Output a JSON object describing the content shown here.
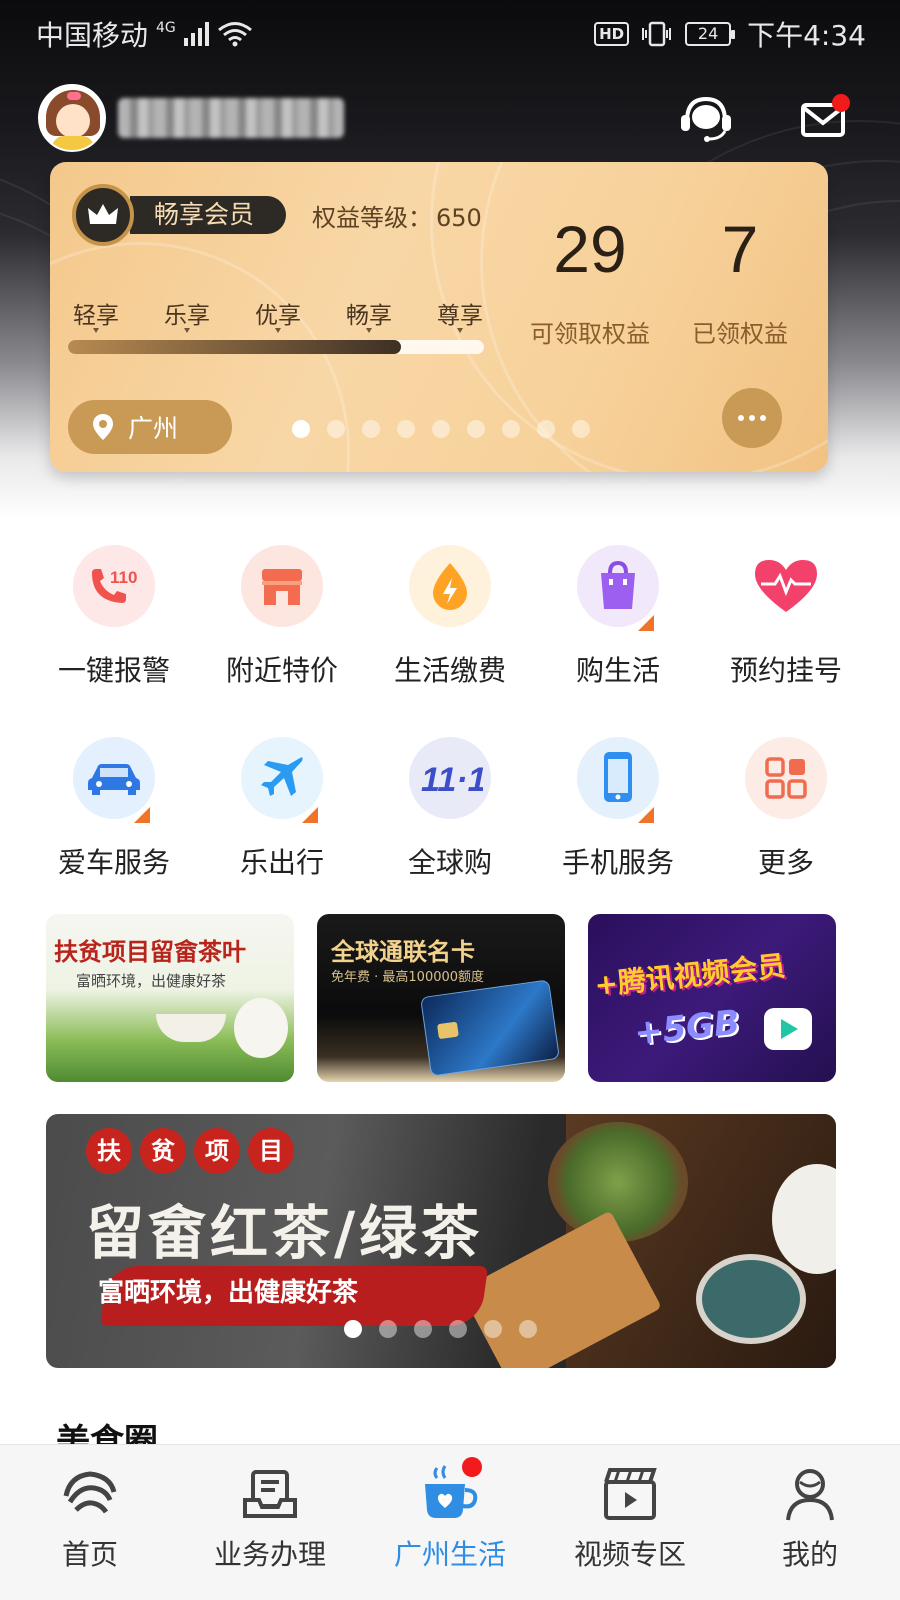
{
  "status_bar": {
    "carrier": "中国移动",
    "network": "4G",
    "hd": "HD",
    "battery": "24",
    "time": "下午4:34"
  },
  "profile": {
    "phone_masked": ""
  },
  "member_card": {
    "tier_name": "畅享会员",
    "level_label": "权益等级：",
    "level_value": "650",
    "tiers": [
      "轻享",
      "乐享",
      "优享",
      "畅享",
      "尊享"
    ],
    "progress": 0.8,
    "available_count": "29",
    "available_label": "可领取权益",
    "claimed_count": "7",
    "claimed_label": "已领权益",
    "location": "广州",
    "page_dots": 9,
    "active_dot": 0
  },
  "services": [
    {
      "label": "一键报警",
      "icon": "alarm-phone-icon",
      "corner": false
    },
    {
      "label": "附近特价",
      "icon": "store-icon",
      "corner": false
    },
    {
      "label": "生活缴费",
      "icon": "utility-drop-icon",
      "corner": false
    },
    {
      "label": "购生活",
      "icon": "shopping-bag-icon",
      "corner": true
    },
    {
      "label": "预约挂号",
      "icon": "heartbeat-icon",
      "corner": false
    },
    {
      "label": "爱车服务",
      "icon": "car-icon",
      "corner": true
    },
    {
      "label": "乐出行",
      "icon": "plane-icon",
      "corner": true
    },
    {
      "label": "全球购",
      "icon": "double-eleven-icon",
      "corner": false
    },
    {
      "label": "手机服务",
      "icon": "smartphone-icon",
      "corner": true
    },
    {
      "label": "更多",
      "icon": "grid-more-icon",
      "corner": false
    }
  ],
  "mini_banners": [
    {
      "title": "扶贫项目留畲茶叶",
      "subtitle": "富晒环境，出健康好茶"
    },
    {
      "title": "全球通联名卡",
      "subtitle": "免年费 · 最高100000额度"
    },
    {
      "title": "+腾讯视频会员",
      "subtitle": "+5GB"
    }
  ],
  "hero_banner": {
    "tags": [
      "扶",
      "贫",
      "项",
      "目"
    ],
    "title": "留畲红茶/绿茶",
    "slogan": "富晒环境，出健康好茶",
    "dots": 6,
    "active_dot": 0
  },
  "next_section_title": "美食圈",
  "tabbar": [
    {
      "label": "首页",
      "icon": "china-mobile-logo-icon",
      "active": false
    },
    {
      "label": "业务办理",
      "icon": "inbox-tray-icon",
      "active": false
    },
    {
      "label": "广州生活",
      "icon": "coffee-cup-icon",
      "active": true
    },
    {
      "label": "视频专区",
      "icon": "video-clapper-icon",
      "active": false
    },
    {
      "label": "我的",
      "icon": "person-icon",
      "active": false
    }
  ],
  "colors": {
    "accent_blue": "#2f8de4",
    "card_gold": "#f6cf97",
    "badge_red": "#f21b1b",
    "corner_orange": "#f07428"
  }
}
